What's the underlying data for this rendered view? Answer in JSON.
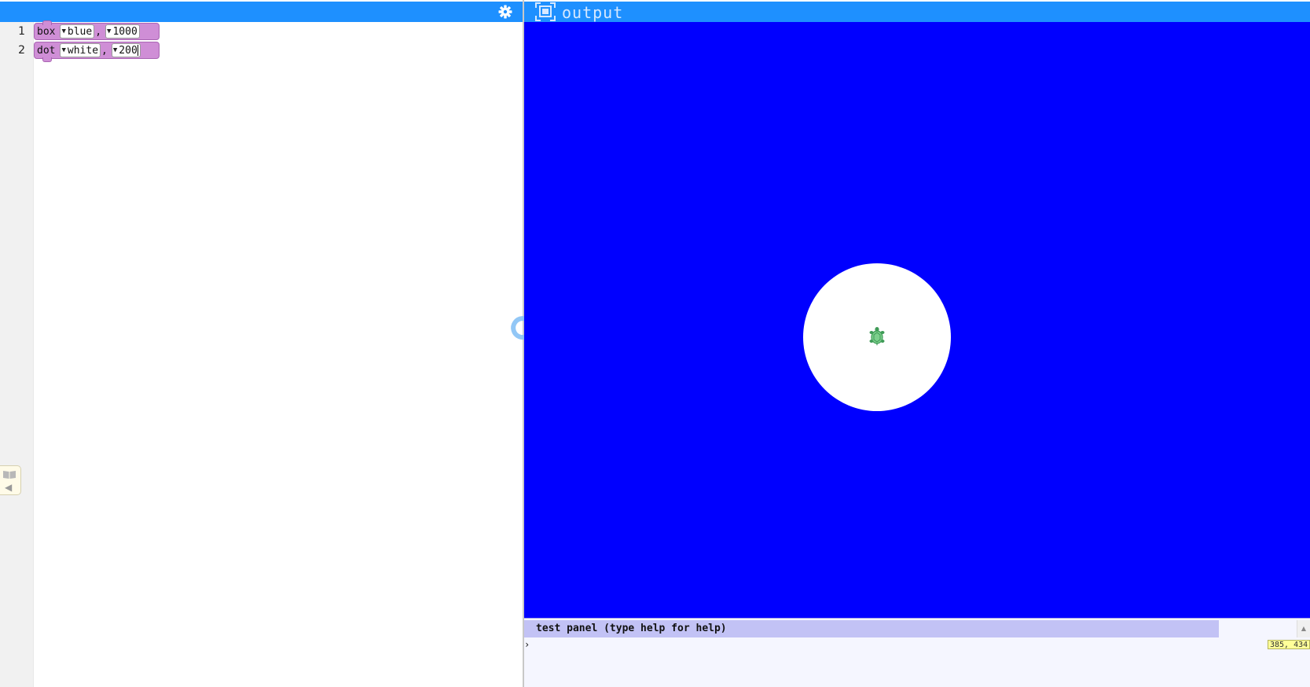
{
  "editor": {
    "settings_icon": "gear-icon",
    "line_numbers": [
      "1",
      "2"
    ],
    "blocks": [
      {
        "command": "box",
        "color_value": "blue",
        "separator": ",",
        "size_value": "1000"
      },
      {
        "command": "dot",
        "color_value": "white",
        "separator": ",",
        "size_value": "200"
      }
    ],
    "dropdown_glyph": "▼",
    "palette_toggle_icon": "book-icon"
  },
  "run_button_icon": "reload-icon",
  "output": {
    "title": "output",
    "title_icon": "fullscreen-icon",
    "canvas_background": "#0000ff",
    "dot_color": "#ffffff",
    "turtle_icon": "turtle-icon"
  },
  "test_panel": {
    "title": "test panel (type help for help)",
    "prompt": "›",
    "input_value": "",
    "coords": "385, 434"
  },
  "colors": {
    "header_blue": "#1e90ff",
    "block_purple": "#cf8ed6",
    "test_header": "#c2c2f5"
  }
}
